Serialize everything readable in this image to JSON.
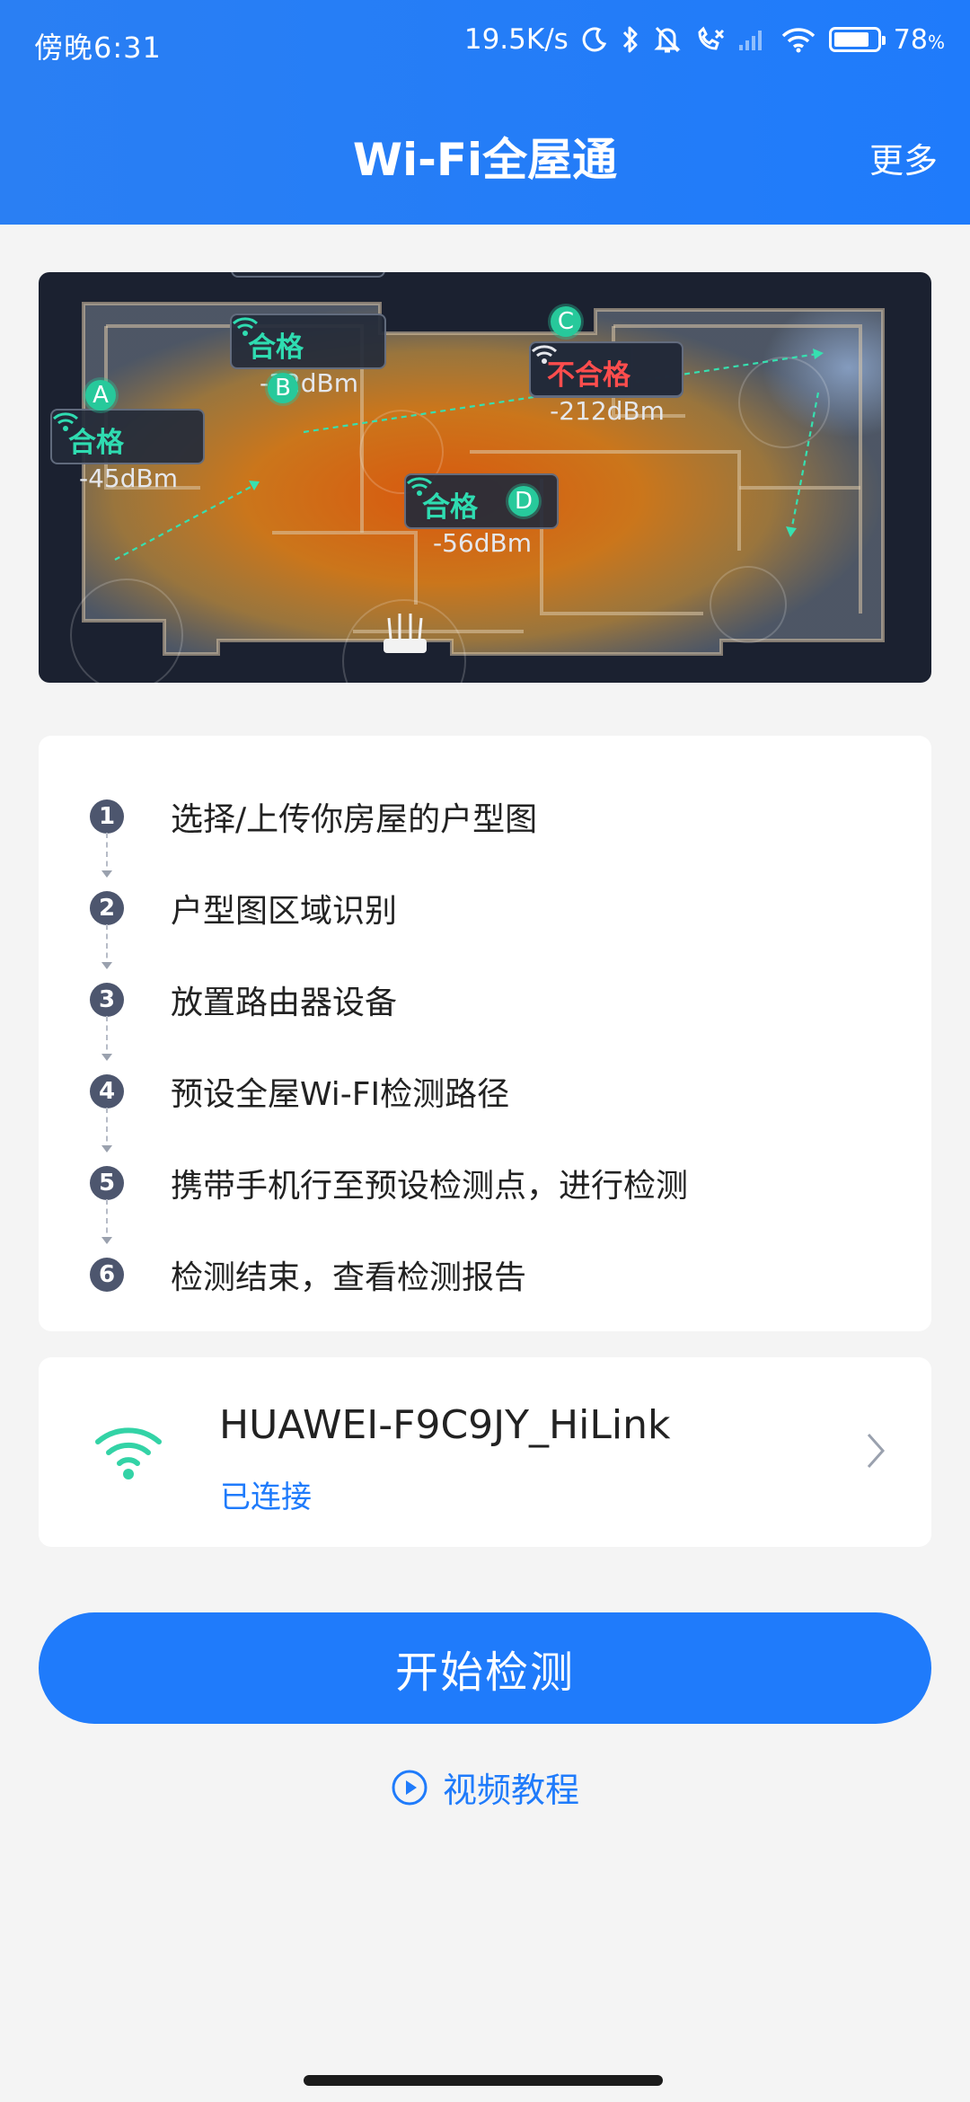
{
  "status_bar": {
    "time": "傍晚6:31",
    "speed": "19.5K/s",
    "battery": "78",
    "battery_unit": "%"
  },
  "header": {
    "title": "Wi-Fi全屋通",
    "more": "更多"
  },
  "map": {
    "points": [
      {
        "id": "A",
        "status": "合格",
        "signal": "-45dBm",
        "ok": true
      },
      {
        "id": "B",
        "status": "合格",
        "signal": "-32dBm",
        "ok": true
      },
      {
        "id": "C",
        "status": "不合格",
        "signal": "-212dBm",
        "ok": false
      },
      {
        "id": "D",
        "status": "合格",
        "signal": "-56dBm",
        "ok": true
      }
    ]
  },
  "steps": [
    {
      "num": "1",
      "label": "选择/上传你房屋的户型图"
    },
    {
      "num": "2",
      "label": "户型图区域识别"
    },
    {
      "num": "3",
      "label": "放置路由器设备"
    },
    {
      "num": "4",
      "label": "预设全屋Wi-FI检测路径"
    },
    {
      "num": "5",
      "label": "携带手机行至预设检测点，进行检测"
    },
    {
      "num": "6",
      "label": "检测结束，查看检测报告"
    }
  ],
  "network": {
    "ssid": "HUAWEI-F9C9JY_HiLink",
    "status": "已连接"
  },
  "actions": {
    "start": "开始检测",
    "video": "视频教程"
  },
  "colors": {
    "primary": "#1f7bfb",
    "ok": "#2fdcb1",
    "bad": "#ff4d4d"
  }
}
